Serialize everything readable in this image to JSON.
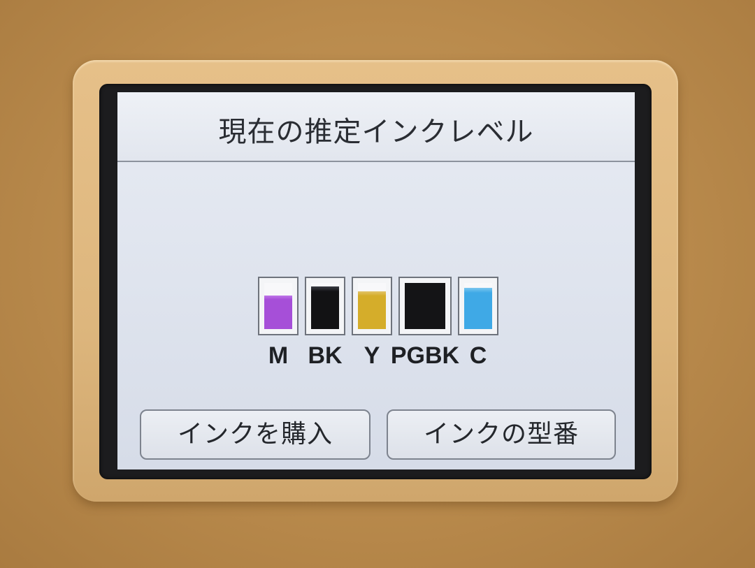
{
  "screen": {
    "title": "現在の推定インクレベル"
  },
  "inks": [
    {
      "label": "M",
      "level": 0.72,
      "color": "#a64fd8",
      "top_color": "#bf76e8"
    },
    {
      "label": "BK",
      "level": 0.92,
      "color": "#121214",
      "top_color": "#3a3c44"
    },
    {
      "label": "Y",
      "level": 0.82,
      "color": "#d5ad2a",
      "top_color": "#e2c46a"
    },
    {
      "label": "PGBK",
      "level": 1.0,
      "color": "#141416",
      "top_color": "#141416"
    },
    {
      "label": "C",
      "level": 0.9,
      "color": "#3fa9e6",
      "top_color": "#7cc6ef"
    }
  ],
  "buttons": {
    "buy_ink": "インクを購入",
    "ink_model": "インクの型番"
  }
}
